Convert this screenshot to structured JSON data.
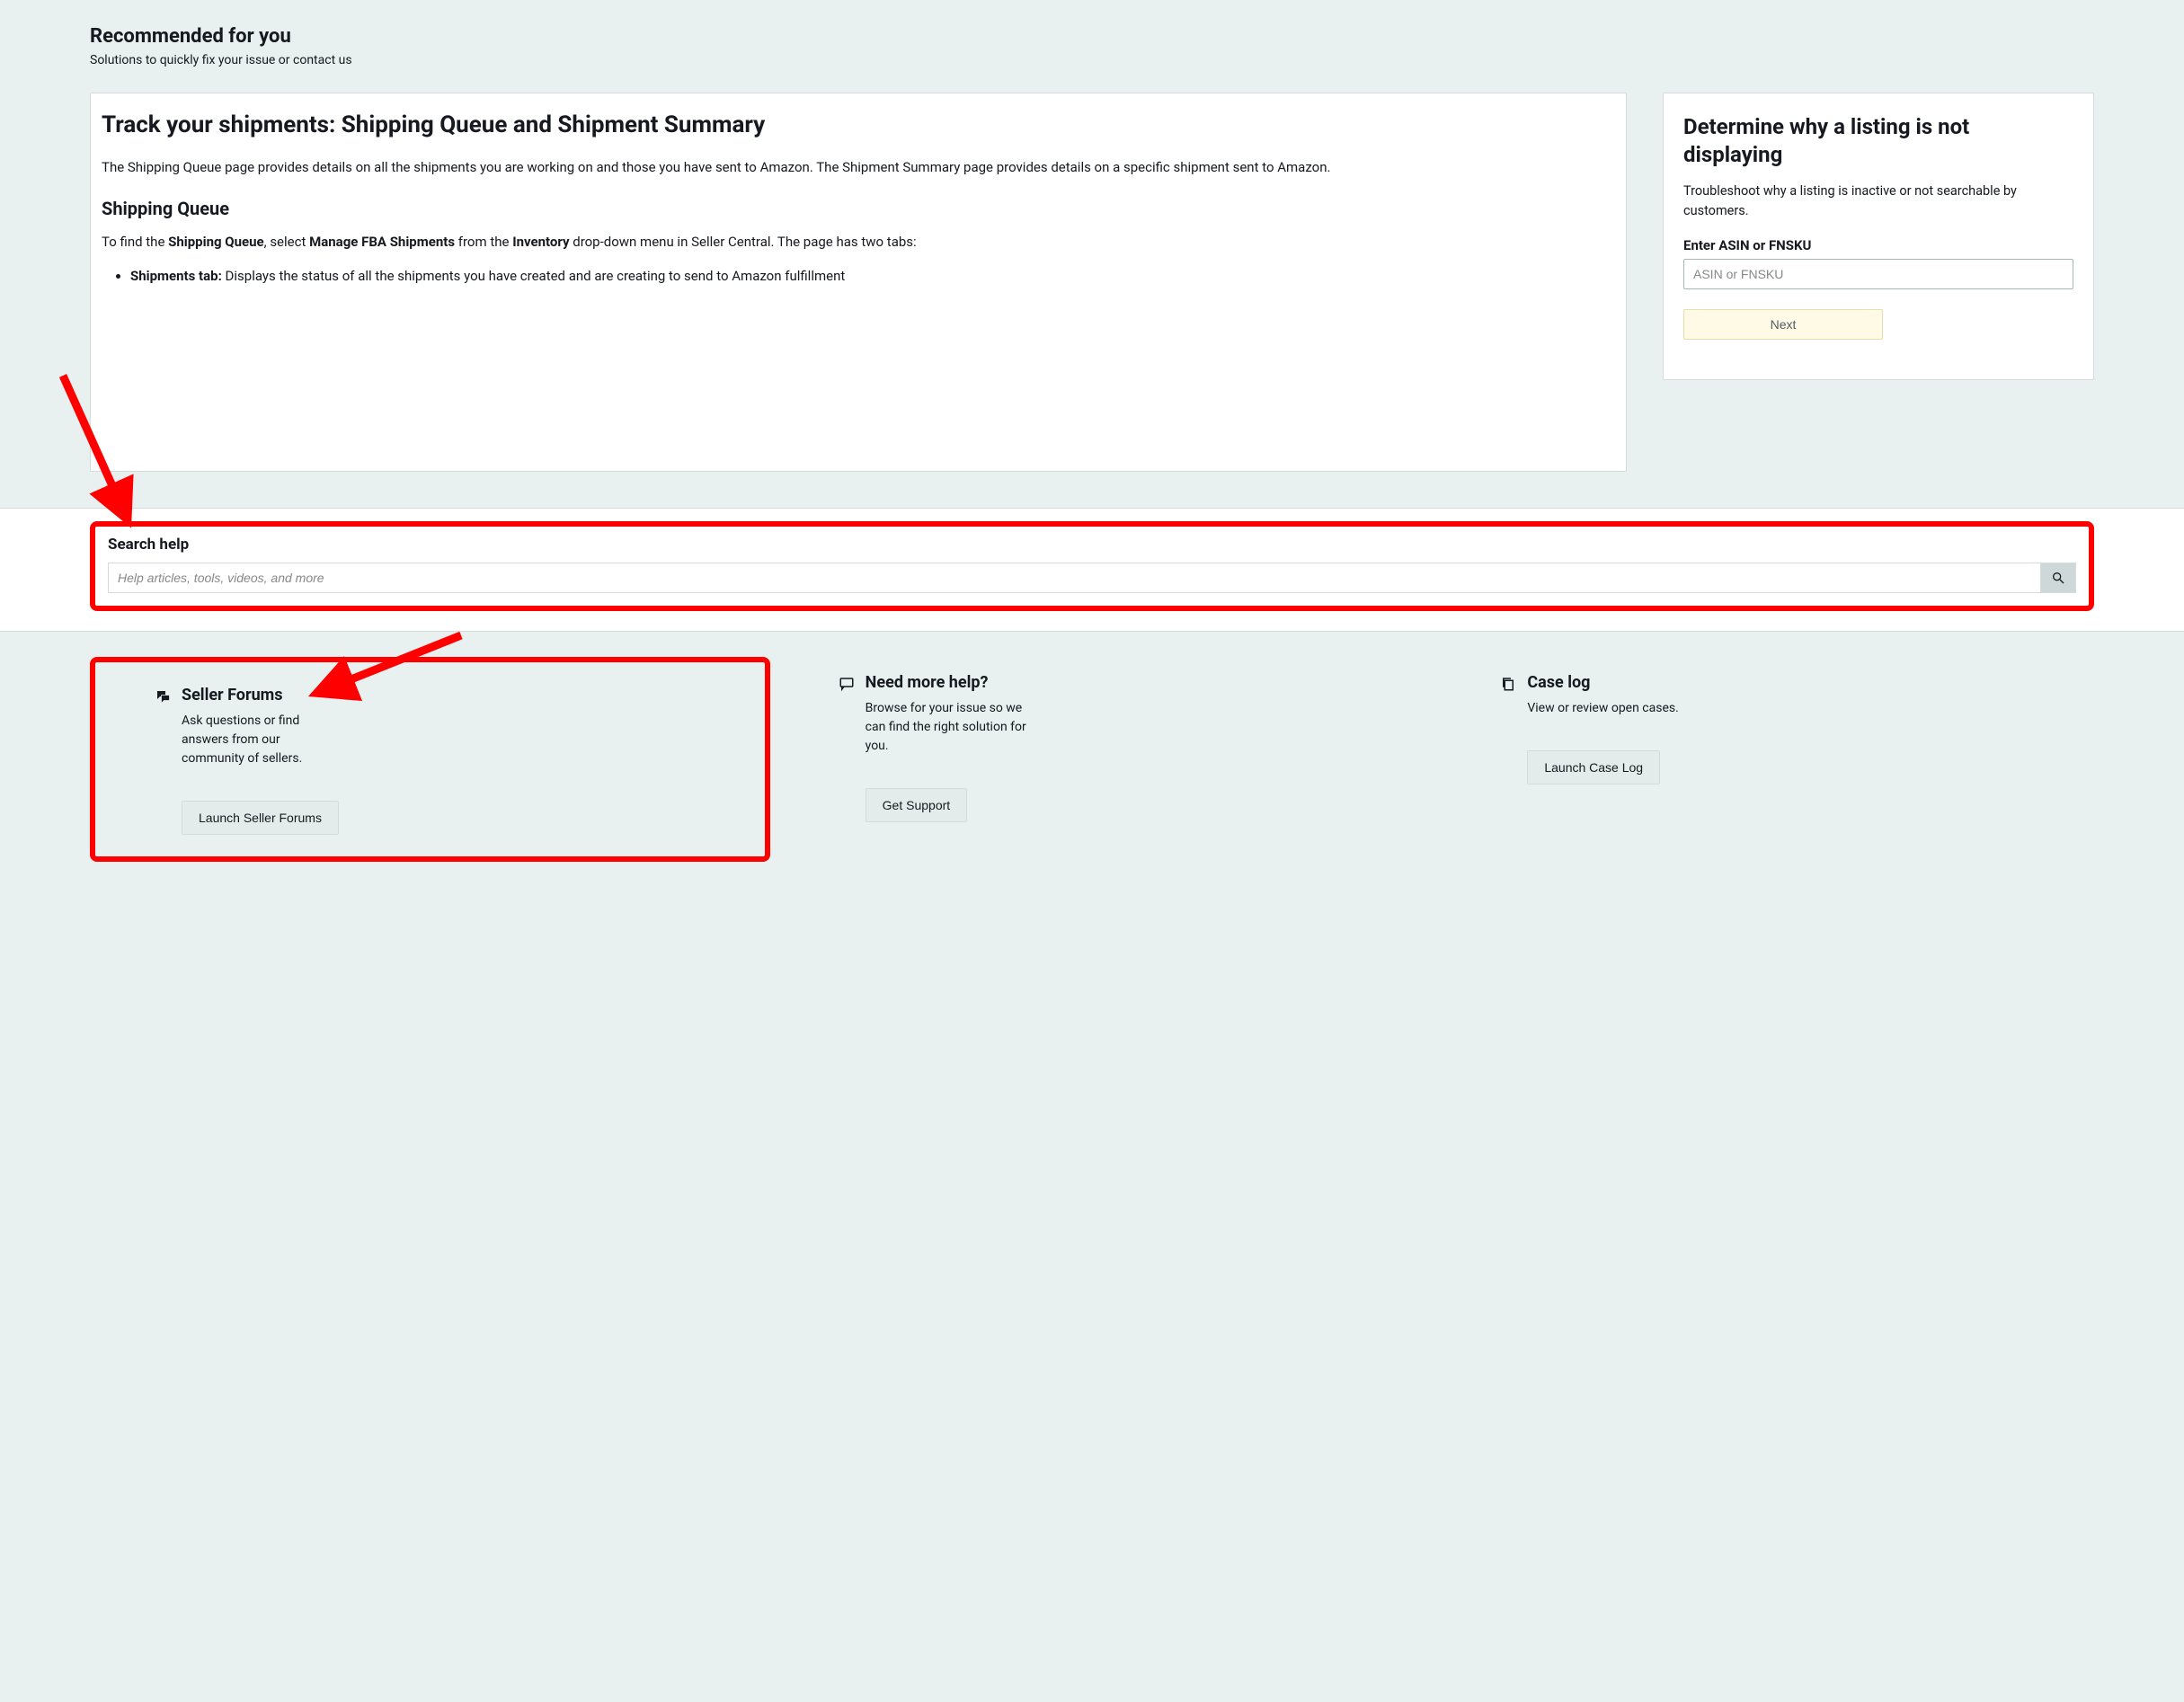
{
  "recommended": {
    "title": "Recommended for you",
    "subtitle": "Solutions to quickly fix your issue or contact us"
  },
  "shipments": {
    "title": "Track your shipments: Shipping Queue and Shipment Summary",
    "intro": "The Shipping Queue page provides details on all the shipments you are working on and those you have sent to Amazon. The Shipment Summary page provides details on a specific shipment sent to Amazon.",
    "h2": "Shipping Queue",
    "find_pre": "To find the ",
    "find_b1": "Shipping Queue",
    "find_mid1": ", select ",
    "find_b2": "Manage FBA Shipments",
    "find_mid2": " from the ",
    "find_b3": "Inventory",
    "find_post": " drop-down menu in Seller Central. The page has two tabs:",
    "li1_b": "Shipments tab:",
    "li1_rest": " Displays the status of all the shipments you have created and are creating to send to Amazon fulfillment"
  },
  "listing": {
    "title": "Determine why a listing is not displaying",
    "desc": "Troubleshoot why a listing is inactive or not searchable by customers.",
    "label": "Enter ASIN or FNSKU",
    "placeholder": "ASIN or FNSKU",
    "next": "Next"
  },
  "search": {
    "title": "Search help",
    "placeholder": "Help articles, tools, videos, and more"
  },
  "forums": {
    "title": "Seller Forums",
    "desc": "Ask questions or find answers from our community of sellers.",
    "button": "Launch Seller Forums"
  },
  "need_help": {
    "title": "Need more help?",
    "desc": "Browse for your issue so we can find the right solution for you.",
    "button": "Get Support"
  },
  "caselog": {
    "title": "Case log",
    "desc": "View or review open cases.",
    "button": "Launch Case Log"
  }
}
